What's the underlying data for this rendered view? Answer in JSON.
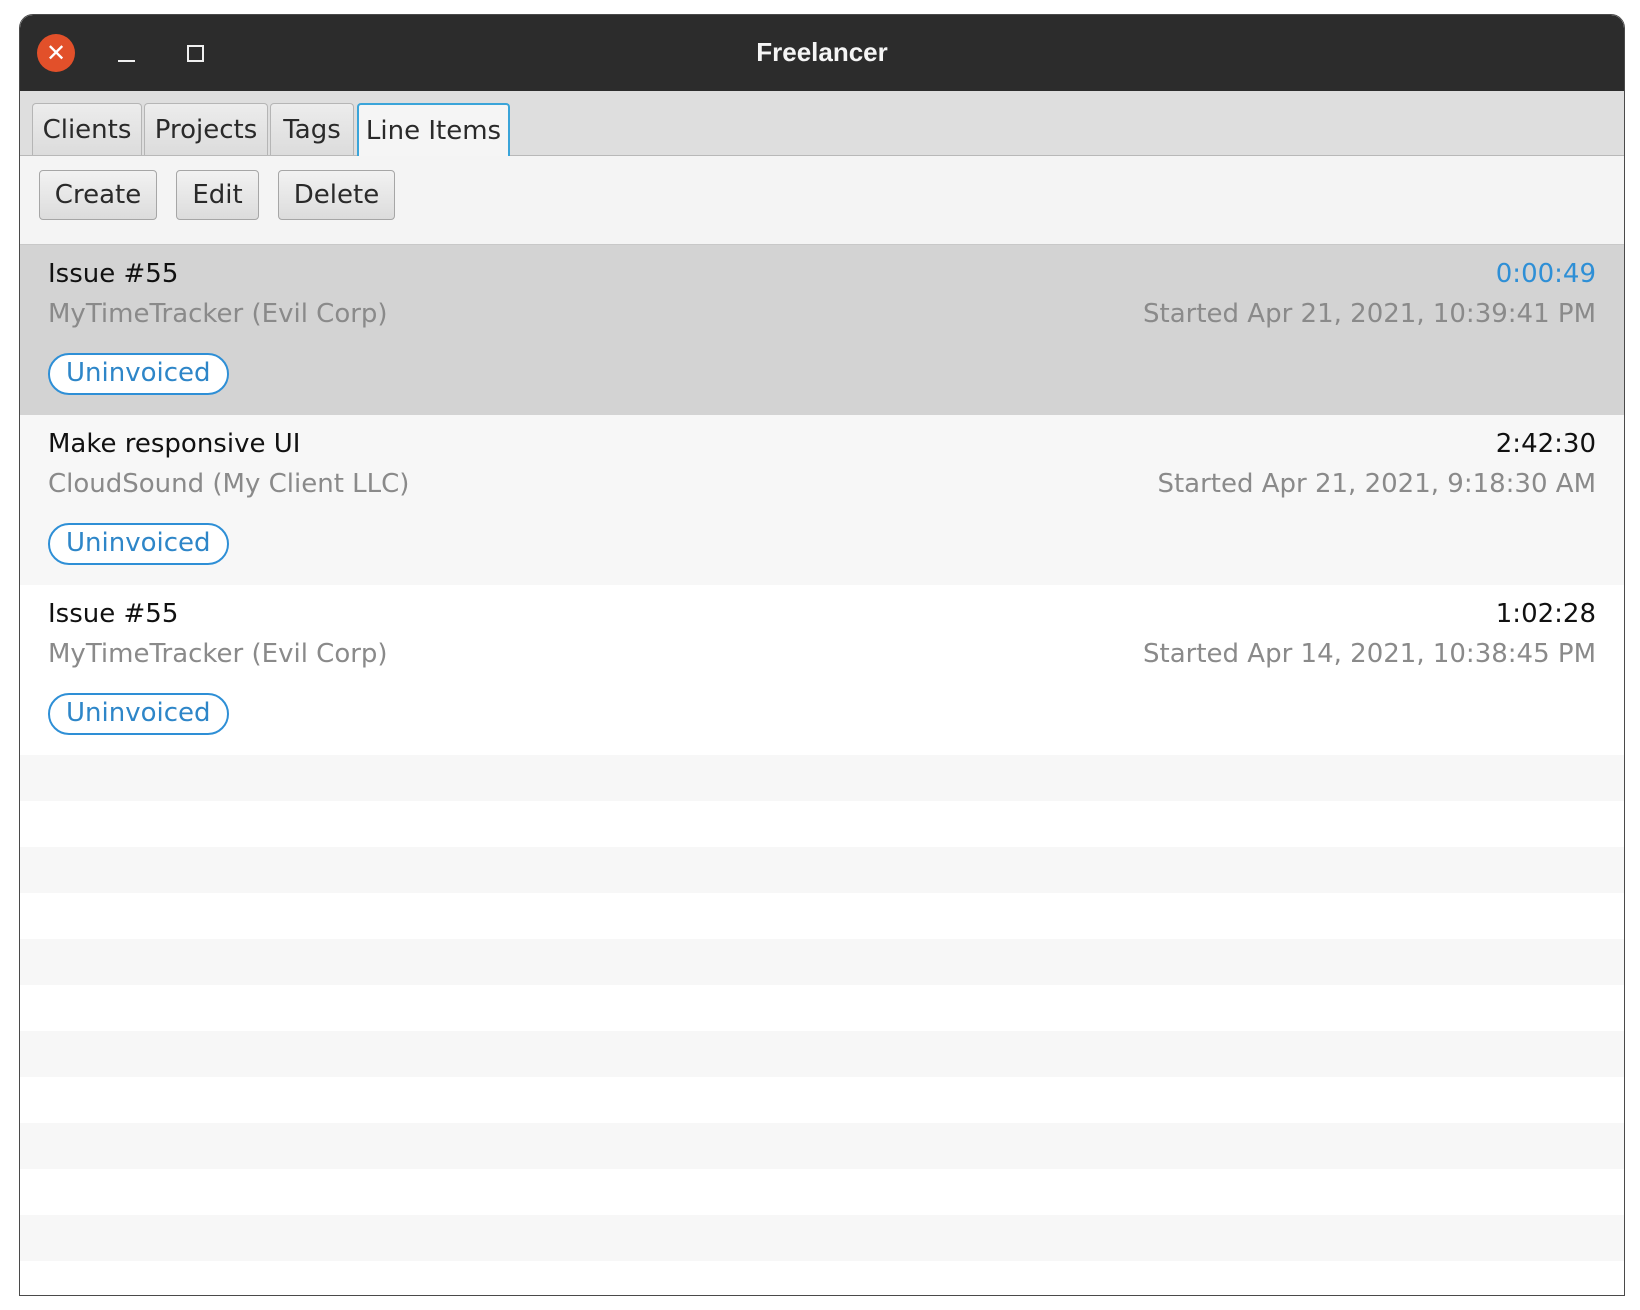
{
  "window": {
    "title": "Freelancer",
    "close_glyph": "✕",
    "close_icon": "close-icon",
    "minimize_icon": "minimize-icon",
    "maximize_icon": "maximize-icon"
  },
  "tabs": [
    {
      "label": "Clients",
      "active": false
    },
    {
      "label": "Projects",
      "active": false
    },
    {
      "label": "Tags",
      "active": false
    },
    {
      "label": "Line Items",
      "active": true
    }
  ],
  "toolbar": {
    "create_label": "Create",
    "edit_label": "Edit",
    "delete_label": "Delete"
  },
  "line_items": [
    {
      "name": "Issue #55",
      "project": "MyTimeTracker (Evil Corp)",
      "duration": "0:00:49",
      "started": "Started Apr 21, 2021, 10:39:41 PM",
      "status": "Uninvoiced",
      "selected": true,
      "running": true
    },
    {
      "name": "Make responsive UI",
      "project": "CloudSound (My Client LLC)",
      "duration": "2:42:30",
      "started": "Started Apr 21, 2021, 9:18:30 AM",
      "status": "Uninvoiced",
      "selected": false,
      "running": false
    },
    {
      "name": "Issue #55",
      "project": "MyTimeTracker (Evil Corp)",
      "duration": "1:02:28",
      "started": "Started Apr 14, 2021, 10:38:45 PM",
      "status": "Uninvoiced",
      "selected": false,
      "running": false
    }
  ],
  "colors": {
    "titlebar": "#2c2c2c",
    "close_button": "#e2502a",
    "selected_row": "#d3d3d3",
    "running_duration": "#2e8fd6",
    "badge_border": "#2e8fd6",
    "active_tab_border": "#3aa4d9"
  }
}
